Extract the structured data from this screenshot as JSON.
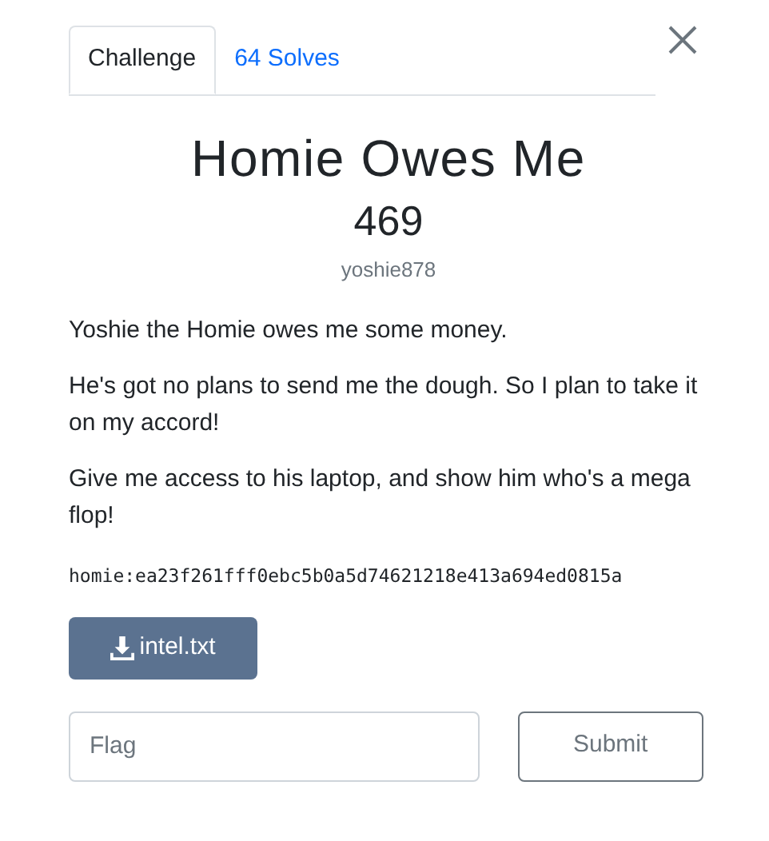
{
  "tabs": [
    {
      "label": "Challenge",
      "selected": true
    },
    {
      "label": "64 Solves",
      "selected": false
    }
  ],
  "challenge": {
    "name": "Homie Owes Me",
    "points": "469",
    "author": "yoshie878",
    "description": [
      "Yoshie the Homie owes me some money.",
      "He's got no plans to send me the dough. So I plan to take it on my accord!",
      "Give me access to his laptop, and show him who's a mega flop!"
    ],
    "code": "homie:ea23f261fff0ebc5b0a5d74621218e413a694ed0815a"
  },
  "files": [
    {
      "label": "intel.txt"
    }
  ],
  "flag_input": {
    "placeholder": "Flag"
  },
  "submit_button": {
    "label": "Submit"
  }
}
